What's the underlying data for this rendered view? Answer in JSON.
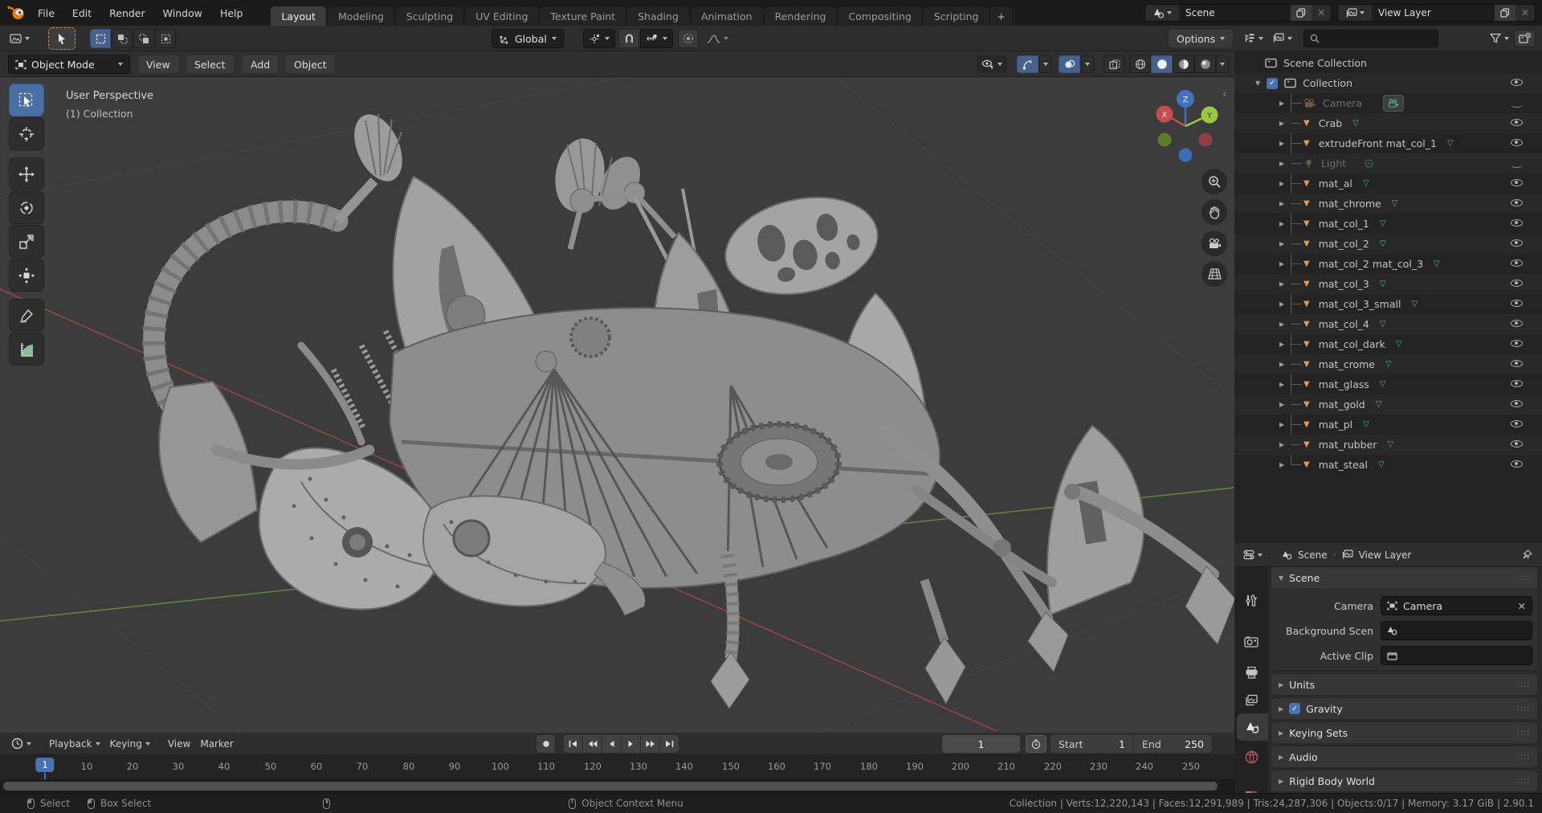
{
  "topbar": {
    "menus": [
      "File",
      "Edit",
      "Render",
      "Window",
      "Help"
    ],
    "tabs": [
      "Layout",
      "Modeling",
      "Sculpting",
      "UV Editing",
      "Texture Paint",
      "Shading",
      "Animation",
      "Rendering",
      "Compositing",
      "Scripting"
    ],
    "active_tab": "Layout",
    "new_tab": "+",
    "scene_selector": "Scene",
    "view_layer_selector": "View Layer"
  },
  "tool_header": {
    "orientation": "Global",
    "options": "Options"
  },
  "viewport": {
    "mode": "Object Mode",
    "menus": [
      "View",
      "Select",
      "Add",
      "Object"
    ],
    "overlay_title": "User Perspective",
    "overlay_subtitle": "(1) Collection",
    "gizmo": {
      "x": "X",
      "y": "Y",
      "z": "Z"
    }
  },
  "outliner": {
    "scene_collection": "Scene Collection",
    "collection": "Collection",
    "items": [
      {
        "label": "Camera"
      },
      {
        "label": "Crab"
      },
      {
        "label": "extrudeFront mat_col_1"
      },
      {
        "label": "Light"
      },
      {
        "label": "mat_al"
      },
      {
        "label": "mat_chrome"
      },
      {
        "label": "mat_col_1"
      },
      {
        "label": "mat_col_2"
      },
      {
        "label": "mat_col_2 mat_col_3"
      },
      {
        "label": "mat_col_3"
      },
      {
        "label": "mat_col_3_small"
      },
      {
        "label": "mat_col_4"
      },
      {
        "label": "mat_col_dark"
      },
      {
        "label": "mat_crome"
      },
      {
        "label": "mat_glass"
      },
      {
        "label": "mat_gold"
      },
      {
        "label": "mat_pl"
      },
      {
        "label": "mat_rubber"
      },
      {
        "label": "mat_steal"
      }
    ]
  },
  "properties": {
    "breadcrumb_scene": "Scene",
    "breadcrumb_view_layer": "View Layer",
    "scene_panel_title": "Scene",
    "camera_label": "Camera",
    "camera_value": "Camera",
    "background_label": "Background Scen",
    "active_clip_label": "Active Clip",
    "panels": [
      "Units",
      "Gravity",
      "Keying Sets",
      "Audio",
      "Rigid Body World"
    ]
  },
  "timeline": {
    "menus": [
      "Playback",
      "Keying",
      "View",
      "Marker"
    ],
    "current_frame": "1",
    "start_label": "Start",
    "start_value": "1",
    "end_label": "End",
    "end_value": "250",
    "ticks": [
      "1",
      "10",
      "20",
      "30",
      "40",
      "50",
      "60",
      "70",
      "80",
      "90",
      "100",
      "110",
      "120",
      "130",
      "140",
      "150",
      "160",
      "170",
      "180",
      "190",
      "200",
      "210",
      "220",
      "230",
      "240",
      "250"
    ]
  },
  "statusbar": {
    "select": "Select",
    "box_select": "Box Select",
    "context_menu": "Object Context Menu",
    "stats": "Collection | Verts:12,220,143 | Faces:12,291,989 | Tris:24,287,306 | Objects:0/17 | Memory: 3.17 GiB | 2.90.1"
  },
  "colors": {
    "accent": "#4772b3",
    "object_orange": "#dd9a5b",
    "data_green": "#49b88a",
    "axis_x": "#cc4b52",
    "axis_y": "#9bc93d",
    "axis_z": "#3f72bf"
  }
}
